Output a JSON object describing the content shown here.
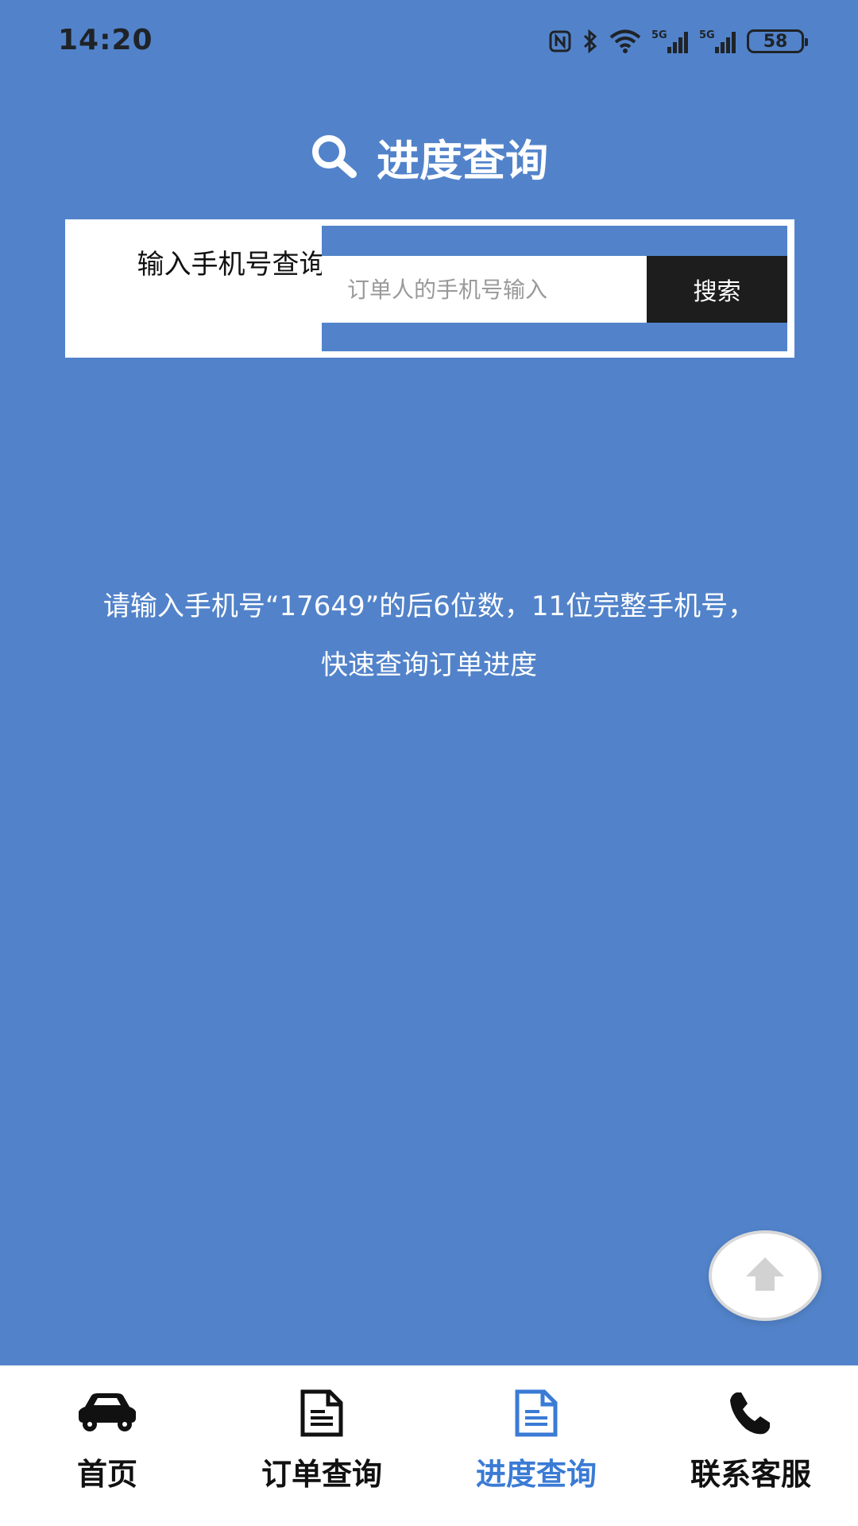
{
  "status_bar": {
    "time": "14:20",
    "battery": "58",
    "icons": [
      "nfc-icon",
      "bluetooth-icon",
      "wifi-icon",
      "signal-5g-icon",
      "signal-5g-icon",
      "battery-icon"
    ]
  },
  "header": {
    "title": "进度查询",
    "icon": "search-icon"
  },
  "search": {
    "label": "输入手机号查询:",
    "placeholder": "订单人的手机号输入",
    "button_label": "搜索"
  },
  "hint": {
    "line1": "请输入手机号“17649”的后6位数，11位完整手机号，",
    "line2": "快速查询订单进度"
  },
  "scroll_top": {
    "icon": "arrow-up-icon"
  },
  "bottom_nav": {
    "items": [
      {
        "label": "首页",
        "icon": "car-icon"
      },
      {
        "label": "订单查询",
        "icon": "document-icon"
      },
      {
        "label": "进度查询",
        "icon": "document-icon",
        "active": true
      },
      {
        "label": "联系客服",
        "icon": "phone-icon"
      }
    ]
  },
  "colors": {
    "background": "#5283ca",
    "active_tab": "#3a7bd5",
    "button": "#1d1d1d"
  }
}
